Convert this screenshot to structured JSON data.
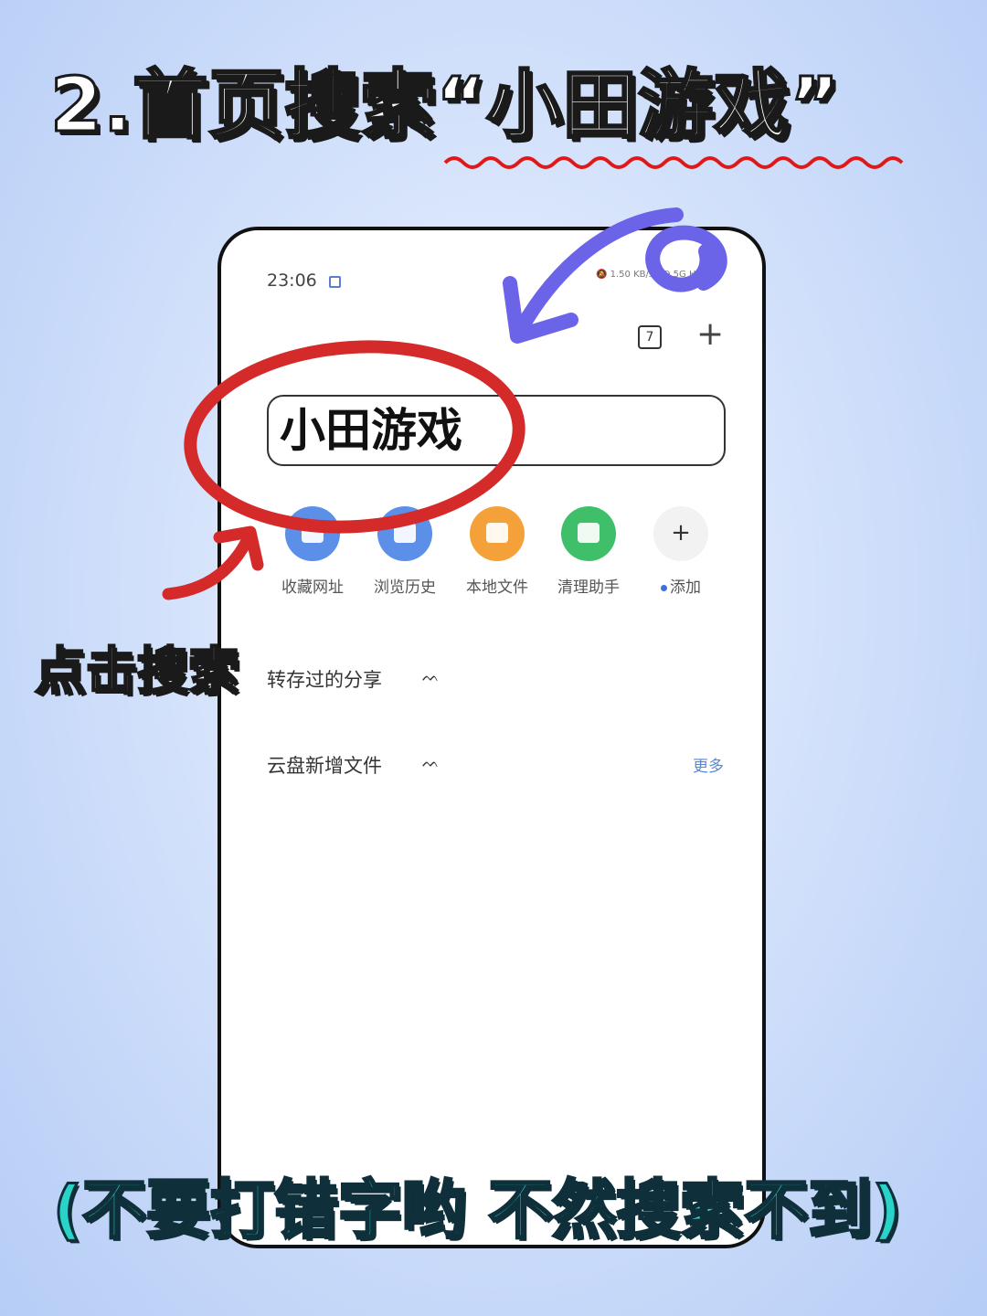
{
  "heading": {
    "text": "2.首页搜索“小田游戏”"
  },
  "status_bar": {
    "time": "23:06",
    "speed": "1.50",
    "speed_unit": "KB/s",
    "network": "HD 5G HD"
  },
  "browser": {
    "tab_count": "7",
    "search_value": "小田游戏",
    "shortcuts": [
      {
        "label": "收藏网址",
        "color": "#5b8fe8",
        "icon": "bookmark-icon"
      },
      {
        "label": "浏览历史",
        "color": "#5b8fe8",
        "icon": "history-icon"
      },
      {
        "label": "本地文件",
        "color": "#f5a13a",
        "icon": "folder-icon"
      },
      {
        "label": "清理助手",
        "color": "#3fbf6a",
        "icon": "cleaner-icon"
      },
      {
        "label": "添加",
        "color": "#f2f2f2",
        "icon": "plus-icon"
      }
    ],
    "sections": [
      {
        "title": "转存过的分享"
      },
      {
        "title": "云盘新增文件",
        "more": "更多"
      }
    ]
  },
  "annotations": {
    "click_label": "点击搜索",
    "warning": "(不要打错字哟 不然搜索不到)",
    "highlight_color": "#d42a2a",
    "arrow_color": "#6b63e8"
  }
}
